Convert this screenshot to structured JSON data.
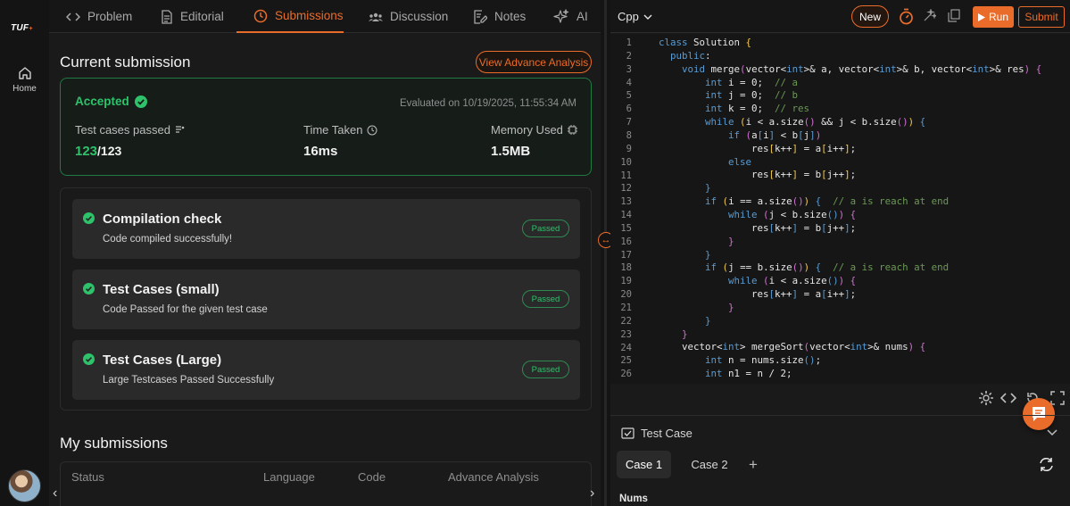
{
  "rail": {
    "logo": "TUF",
    "logo_sup": "+",
    "home_label": "Home"
  },
  "tabs": [
    {
      "label": "Problem",
      "icon": "code-brackets-icon"
    },
    {
      "label": "Editorial",
      "icon": "document-icon"
    },
    {
      "label": "Submissions",
      "icon": "clock-icon",
      "active": true
    },
    {
      "label": "Discussion",
      "icon": "people-icon"
    },
    {
      "label": "Notes",
      "icon": "note-edit-icon"
    },
    {
      "label": "AI",
      "icon": "sparkle-icon"
    }
  ],
  "current": {
    "heading": "Current submission",
    "analysis_button": "View Advance Analysis",
    "status": "Accepted",
    "evaluated": "Evaluated on 10/19/2025, 11:55:34 AM",
    "test_cases_label": "Test cases passed",
    "test_cases_passed": "123",
    "test_cases_total": "/123",
    "time_label": "Time Taken",
    "time_value": "16ms",
    "memory_label": "Memory Used",
    "memory_value": "1.5MB"
  },
  "checks": [
    {
      "title": "Compilation check",
      "desc": "Code compiled successfully!",
      "badge": "Passed"
    },
    {
      "title": "Test Cases (small)",
      "desc": "Code Passed for the given test case",
      "badge": "Passed"
    },
    {
      "title": "Test Cases (Large)",
      "desc": "Large Testcases Passed Successfully",
      "badge": "Passed"
    }
  ],
  "my_submissions": {
    "heading": "My submissions",
    "columns": [
      "Status",
      "Language",
      "Code",
      "Advance Analysis"
    ]
  },
  "editor": {
    "language": "Cpp",
    "new_label": "New",
    "run_label": "Run",
    "submit_label": "Submit",
    "line_numbers": [
      "1",
      "2",
      "3",
      "4",
      "5",
      "6",
      "7",
      "8",
      "9",
      "10",
      "11",
      "12",
      "13",
      "14",
      "15",
      "16",
      "17",
      "18",
      "19",
      "20",
      "21",
      "22",
      "23",
      "24",
      "25",
      "26"
    ]
  },
  "testcase": {
    "title": "Test Case",
    "cases": [
      "Case 1",
      "Case 2"
    ],
    "add_label": "+",
    "field_label": "Nums"
  },
  "colors": {
    "accent": "#ea6c2a",
    "success": "#2ec26b"
  }
}
